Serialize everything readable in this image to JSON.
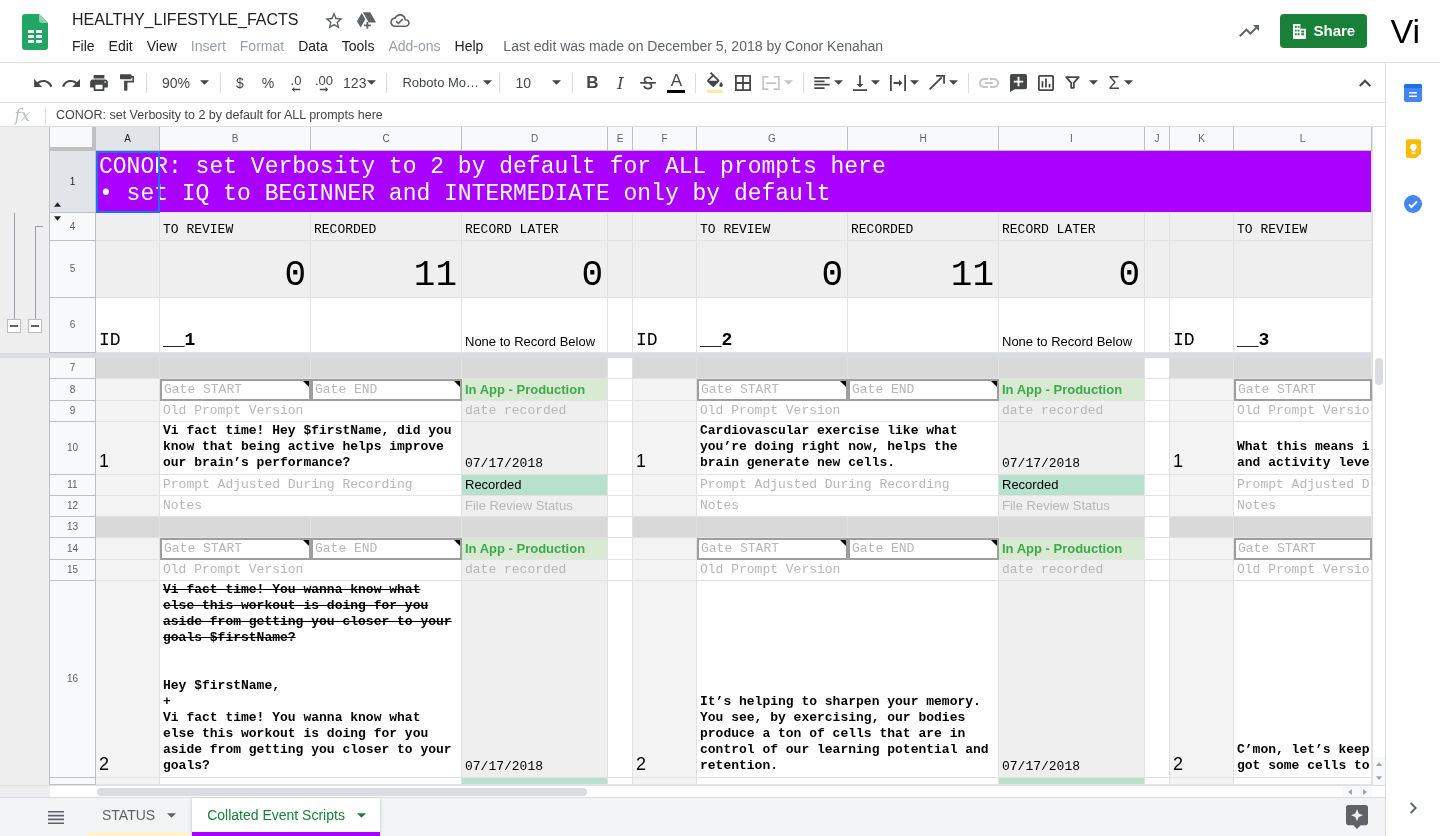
{
  "app": {
    "title": "HEALTHY_LIFESTYLE_FACTS",
    "menu": [
      {
        "label": "File",
        "disabled": false
      },
      {
        "label": "Edit",
        "disabled": false
      },
      {
        "label": "View",
        "disabled": false
      },
      {
        "label": "Insert",
        "disabled": true
      },
      {
        "label": "Format",
        "disabled": true
      },
      {
        "label": "Data",
        "disabled": false
      },
      {
        "label": "Tools",
        "disabled": false
      },
      {
        "label": "Add-ons",
        "disabled": true
      },
      {
        "label": "Help",
        "disabled": false
      }
    ],
    "last_edit": "Last edit was made on December 5, 2018 by Conor Kenahan",
    "share": "Share",
    "account": "Vi"
  },
  "toolbar": {
    "zoom": "90%",
    "currency": "$",
    "percent": "%",
    "decrease_decimals": ".0",
    "increase_decimals": ".00",
    "more_formats": "123",
    "font": "Roboto Mo…",
    "font_size": "10",
    "bold": "B",
    "italic": "I",
    "text_color": "A",
    "functions": "Σ",
    "merge_disabled": true,
    "link_disabled": true
  },
  "formula_bar": {
    "label": "fx",
    "value": "CONOR: set Verbosity to 2 by default for ALL prompts here"
  },
  "sheet": {
    "banner": "CONOR: set Verbosity to 2 by default for ALL prompts here\n• set IQ to BEGINNER and INTERMEDIATE only by default",
    "columns": [
      {
        "label": "A",
        "selected": true
      },
      {
        "label": "B",
        "selected": false
      },
      {
        "label": "C",
        "selected": false
      },
      {
        "label": "D",
        "selected": false
      },
      {
        "label": "E",
        "selected": false
      },
      {
        "label": "F",
        "selected": false
      },
      {
        "label": "G",
        "selected": false
      },
      {
        "label": "H",
        "selected": false
      },
      {
        "label": "I",
        "selected": false
      },
      {
        "label": "J",
        "selected": false
      },
      {
        "label": "K",
        "selected": false
      },
      {
        "label": "L",
        "selected": false
      }
    ],
    "rows": [
      {
        "number": "1",
        "kind": "banner",
        "selected": true,
        "hidden_rows_below": true,
        "frozen_divider_below": false
      },
      {
        "number": "4",
        "kind": "headers",
        "selected": false,
        "hidden_rows_below": false,
        "frozen_divider_below": false
      },
      {
        "number": "5",
        "kind": "counts",
        "selected": false,
        "hidden_rows_below": false,
        "frozen_divider_below": false
      },
      {
        "number": "6",
        "kind": "ids",
        "selected": false,
        "hidden_rows_below": false,
        "frozen_divider_below": true
      },
      {
        "number": "7",
        "kind": "band",
        "selected": false,
        "hidden_rows_below": false,
        "frozen_divider_below": false
      },
      {
        "number": "8",
        "kind": "gate",
        "selected": false,
        "hidden_rows_below": false,
        "frozen_divider_below": false
      },
      {
        "number": "9",
        "kind": "old",
        "selected": false,
        "hidden_rows_below": false,
        "frozen_divider_below": false
      },
      {
        "number": "10",
        "kind": "prompt",
        "selected": false,
        "hidden_rows_below": false,
        "frozen_divider_below": false
      },
      {
        "number": "11",
        "kind": "adjusted",
        "selected": false,
        "hidden_rows_below": false,
        "frozen_divider_below": false
      },
      {
        "number": "12",
        "kind": "notes",
        "selected": false,
        "hidden_rows_below": false,
        "frozen_divider_below": false
      },
      {
        "number": "13",
        "kind": "band",
        "selected": false,
        "hidden_rows_below": false,
        "frozen_divider_below": false
      },
      {
        "number": "14",
        "kind": "gate",
        "selected": false,
        "hidden_rows_below": false,
        "frozen_divider_below": false
      },
      {
        "number": "15",
        "kind": "old",
        "selected": false,
        "hidden_rows_below": false,
        "frozen_divider_below": false
      },
      {
        "number": "16",
        "kind": "prompt",
        "selected": false,
        "hidden_rows_below": false,
        "frozen_divider_below": false
      },
      {
        "kind": "adjusted",
        "selected": false,
        "hidden_rows_below": false,
        "frozen_divider_below": false
      }
    ],
    "row_groups": [
      {
        "expanded": true
      },
      {
        "expanded": true
      }
    ],
    "blocks": [
      {
        "id_label": "ID",
        "id_value": "__1",
        "headers": [
          "TO REVIEW",
          "RECORDED",
          "RECORD LATER"
        ],
        "counts": [
          "0",
          "11",
          "0"
        ],
        "note": "None to Record Below",
        "entries": [
          {
            "number": "1",
            "gate_start": {
              "text": "Gate START",
              "has_note": true
            },
            "gate_end": {
              "text": "Gate END",
              "has_note": true
            },
            "stage": "In App - Production",
            "old_prompt": "Old Prompt Version",
            "date_label": "date recorded",
            "prompt": [
              {
                "text": "Vi fact time! Hey $firstName, did you know that being active helps improve our brain’s performance?",
                "struck": false
              }
            ],
            "date": "07/17/2018",
            "adjusted": "Prompt Adjusted During Recording",
            "recording": "Recorded",
            "notes": "Notes",
            "review": "File Review Status"
          },
          {
            "number": "2",
            "gate_start": {
              "text": "Gate START",
              "has_note": true
            },
            "gate_end": {
              "text": "Gate END",
              "has_note": true
            },
            "stage": "In App - Production",
            "old_prompt": "Old Prompt Version",
            "date_label": "date recorded",
            "prompt": [
              {
                "text": "Vi fact time! You wanna know what else this workout is doing for you aside from getting you closer to your goals $firstName?",
                "struck": true
              },
              {
                "text": "Hey $firstName,\n+\nVi fact time! You wanna know what else this workout is doing for you aside from getting you closer to your goals?",
                "struck": false
              }
            ],
            "date": "07/17/2018"
          }
        ]
      },
      {
        "id_label": "ID",
        "id_value": "__2",
        "headers": [
          "TO REVIEW",
          "RECORDED",
          "RECORD LATER"
        ],
        "counts": [
          "0",
          "11",
          "0"
        ],
        "note": "None to Record Below",
        "entries": [
          {
            "number": "1",
            "gate_start": {
              "text": "Gate START",
              "has_note": true
            },
            "gate_end": {
              "text": "Gate END",
              "has_note": true
            },
            "stage": "In App - Production",
            "old_prompt": "Old Prompt Version",
            "date_label": "date recorded",
            "prompt": [
              {
                "text": "Cardiovascular exercise like what you’re doing right now, helps the brain generate new cells.",
                "struck": false
              }
            ],
            "date": "07/17/2018",
            "adjusted": "Prompt Adjusted During Recording",
            "recording": "Recorded",
            "notes": "Notes",
            "review": "File Review Status"
          },
          {
            "number": "2",
            "gate_start": {
              "text": "Gate START",
              "has_note": true
            },
            "gate_end": {
              "text": "Gate END",
              "has_note": true
            },
            "stage": "In App - Production",
            "old_prompt": "Old Prompt Version",
            "date_label": "date recorded",
            "prompt": [
              {
                "text": "It’s helping to sharpen your memory. You see, by exercising, our bodies produce a ton of cells that are in control of our learning potential and retention.",
                "struck": false
              }
            ],
            "date": "07/17/2018"
          }
        ]
      },
      {
        "id_label": "ID",
        "id_value": "__3",
        "headers": [
          "TO REVIEW"
        ],
        "entries": [
          {
            "number": "1",
            "gate_start": {
              "text": "Gate START",
              "has_note": false
            },
            "old_prompt": "Old Prompt Versio",
            "prompt": [
              {
                "text": "What this means i and activity leve",
                "struck": false
              }
            ],
            "adjusted": "Prompt Adjusted D",
            "notes": "Notes"
          },
          {
            "number": "2",
            "gate_start": {
              "text": "Gate START",
              "has_note": false
            },
            "old_prompt": "Old Prompt Versio",
            "prompt": [
              {
                "text": "C’mon, let’s keep got some cells to",
                "struck": false
              }
            ]
          }
        ]
      }
    ]
  },
  "sheet_tabs": [
    {
      "label": "STATUS",
      "selected": false,
      "color": "#fff2cc"
    },
    {
      "label": "Collated Event Scripts",
      "selected": true,
      "color": "#aa00ff"
    }
  ]
}
